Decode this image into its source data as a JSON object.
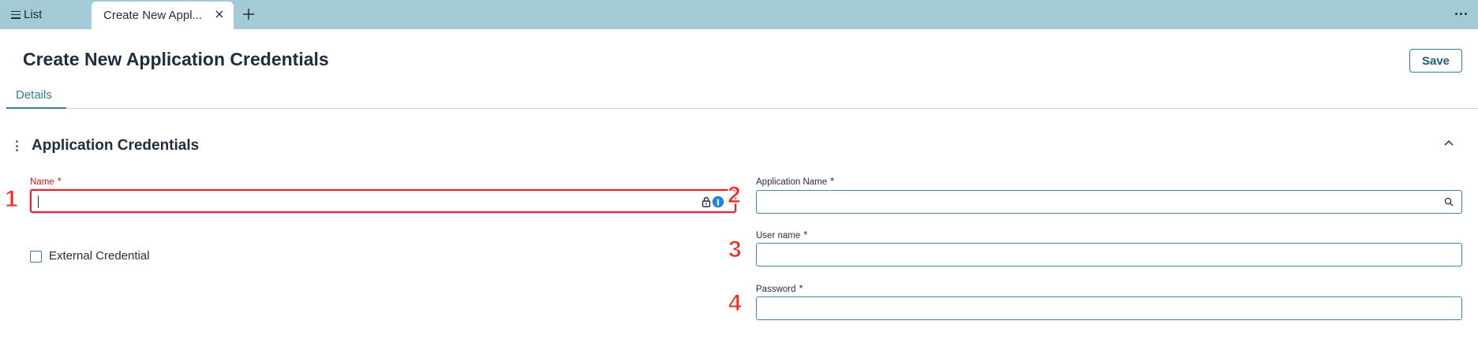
{
  "tabs": {
    "list_label": "List",
    "active_label": "Create New Appl...",
    "more_label": "···"
  },
  "header": {
    "title": "Create New Application Credentials",
    "save_label": "Save"
  },
  "detail_tabs": {
    "details_label": "Details"
  },
  "section": {
    "title": "Application Credentials"
  },
  "fields": {
    "name": {
      "label": "Name",
      "required_mark": "*",
      "value": ""
    },
    "application_name": {
      "label": "Application Name",
      "required_mark": "*",
      "value": ""
    },
    "user_name": {
      "label": "User name",
      "required_mark": "*",
      "value": ""
    },
    "password": {
      "label": "Password",
      "required_mark": "*",
      "value": ""
    },
    "external_credential": {
      "label": "External Credential",
      "checked": false
    }
  },
  "annotations": [
    "1",
    "2",
    "3",
    "4"
  ],
  "colors": {
    "tab_strip": "#a3cbd7",
    "accent": "#3a7b95",
    "error": "#e3232d",
    "annotation": "#f0261f"
  },
  "icons": [
    "hamburger-icon",
    "close-icon",
    "plus-icon",
    "more-icon",
    "drag-handle-icon",
    "chevron-up-icon",
    "lock-icon",
    "onepassword-icon",
    "search-icon"
  ]
}
